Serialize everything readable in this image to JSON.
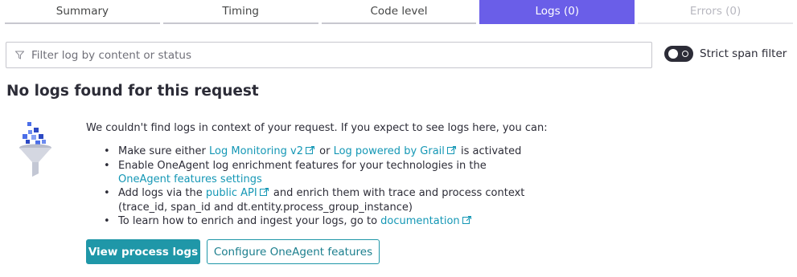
{
  "tabs": [
    {
      "label": "Summary",
      "state": "normal"
    },
    {
      "label": "Timing",
      "state": "normal"
    },
    {
      "label": "Code level",
      "state": "normal"
    },
    {
      "label": "Logs (0)",
      "state": "active"
    },
    {
      "label": "Errors (0)",
      "state": "disabled"
    }
  ],
  "filter": {
    "placeholder": "Filter log by content or status",
    "value": "",
    "icon": "filter-funnel-icon"
  },
  "strict_span_filter": {
    "label": "Strict span filter",
    "enabled": false
  },
  "empty_state": {
    "title": "No logs found for this request",
    "illustration": "funnel-illustration",
    "intro": "We couldn't find logs in context of your request. If you expect to see logs here, you can:",
    "bullets": {
      "b1_prefix": "Make sure either ",
      "b1_link1": "Log Monitoring v2",
      "b1_mid": " or ",
      "b1_link2": "Log powered by Grail",
      "b1_suffix": " is activated",
      "b2_prefix": "Enable OneAgent log enrichment features for your technologies in the ",
      "b2_link": "OneAgent features settings",
      "b3_prefix": "Add logs via the ",
      "b3_link": "public API",
      "b3_suffix": " and enrich them with trace and process context (trace_id, span_id and dt.entity.process_group_instance)",
      "b4_prefix": "To learn how to enrich and ingest your logs, go to ",
      "b4_link": "documentation"
    }
  },
  "buttons": {
    "primary": "View process logs",
    "secondary": "Configure OneAgent features"
  },
  "colors": {
    "tab_active": "#6a5ee8",
    "link": "#1497b5",
    "button_primary": "#1f97a8",
    "text": "#2c2c37"
  }
}
